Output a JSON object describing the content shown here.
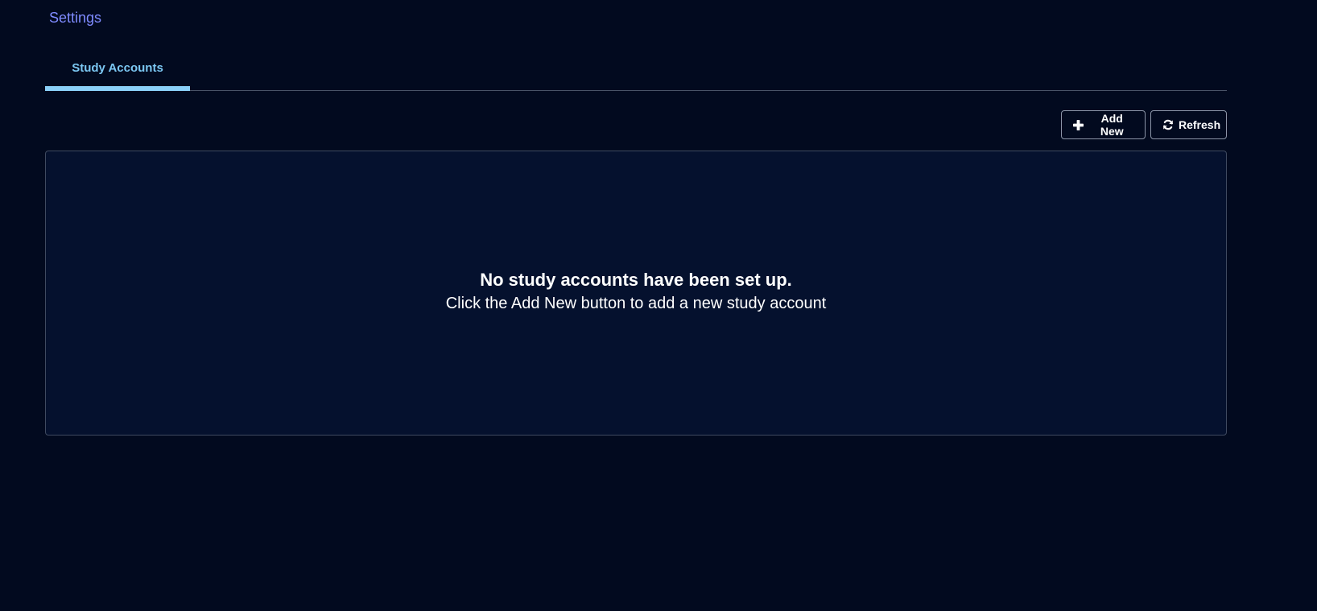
{
  "breadcrumb": {
    "label": "Settings"
  },
  "tabs": [
    {
      "label": "Study Accounts",
      "active": true
    }
  ],
  "toolbar": {
    "add_label": "Add New",
    "add_icon": "plus-icon",
    "refresh_label": "Refresh",
    "refresh_icon": "refresh-icon"
  },
  "empty_state": {
    "title": "No study accounts have been set up.",
    "subtitle": "Click the Add New button to add a new study account"
  },
  "colors": {
    "background": "#020a1f",
    "panel": "#05112e",
    "accent": "#8ad0f8",
    "link": "#7f8bff"
  }
}
